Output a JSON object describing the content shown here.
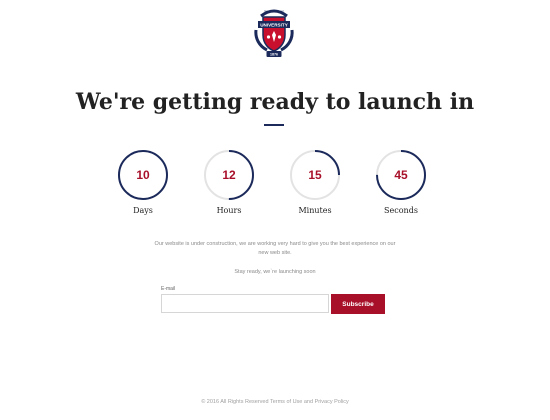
{
  "logo": {
    "top_text": "Founded School",
    "banner_text": "UNIVERSITY",
    "year": "1876",
    "colors": {
      "navy": "#1b2a5b",
      "red": "#c8102e"
    }
  },
  "headline": "We're getting ready to launch in",
  "countdown": [
    {
      "value": "10",
      "label": "Days",
      "progress": 1.0
    },
    {
      "value": "12",
      "label": "Hours",
      "progress": 0.5
    },
    {
      "value": "15",
      "label": "Minutes",
      "progress": 0.25
    },
    {
      "value": "45",
      "label": "Seconds",
      "progress": 0.75
    }
  ],
  "description": "Our website is under construction, we are working very hard to give you the best experience on our new web site.",
  "stay_ready": "Stay ready, we`re launching soon",
  "subscribe_form": {
    "email_label": "E-mail",
    "email_value": "",
    "button_label": "Subscribe"
  },
  "footer": "© 2016 All Rights Reserved Terms of Use and Privacy Policy",
  "colors": {
    "accent_red": "#a8102a",
    "navy": "#1b2a5b",
    "track_gray": "#e3e3e3"
  }
}
